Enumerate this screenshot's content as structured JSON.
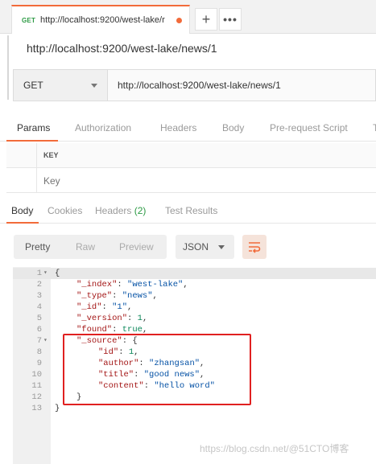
{
  "tab": {
    "method": "GET",
    "title": "http://localhost:9200/west-lake/r"
  },
  "request": {
    "name": "http://localhost:9200/west-lake/news/1",
    "method": "GET",
    "url": "http://localhost:9200/west-lake/news/1"
  },
  "request_tabs": [
    "Params",
    "Authorization",
    "Headers",
    "Body",
    "Pre-request Script",
    "T"
  ],
  "params": {
    "key_header": "KEY",
    "key_placeholder": "Key"
  },
  "response_tabs": {
    "body": "Body",
    "cookies": "Cookies",
    "headers": "Headers",
    "headers_count": "(2)",
    "tests": "Test Results"
  },
  "view_modes": [
    "Pretty",
    "Raw",
    "Preview"
  ],
  "format": "JSON",
  "code_lines": [
    {
      "n": "1",
      "fold": true,
      "indent": 0,
      "parts": [
        [
          "p",
          "{"
        ]
      ]
    },
    {
      "n": "2",
      "indent": 1,
      "parts": [
        [
          "k",
          "\"_index\""
        ],
        [
          "p",
          ": "
        ],
        [
          "s",
          "\"west-lake\""
        ],
        [
          "p",
          ","
        ]
      ]
    },
    {
      "n": "3",
      "indent": 1,
      "parts": [
        [
          "k",
          "\"_type\""
        ],
        [
          "p",
          ": "
        ],
        [
          "s",
          "\"news\""
        ],
        [
          "p",
          ","
        ]
      ]
    },
    {
      "n": "4",
      "indent": 1,
      "parts": [
        [
          "k",
          "\"_id\""
        ],
        [
          "p",
          ": "
        ],
        [
          "s",
          "\"1\""
        ],
        [
          "p",
          ","
        ]
      ]
    },
    {
      "n": "5",
      "indent": 1,
      "parts": [
        [
          "k",
          "\"_version\""
        ],
        [
          "p",
          ": "
        ],
        [
          "n",
          "1"
        ],
        [
          "p",
          ","
        ]
      ]
    },
    {
      "n": "6",
      "indent": 1,
      "parts": [
        [
          "k",
          "\"found\""
        ],
        [
          "p",
          ": "
        ],
        [
          "n",
          "true"
        ],
        [
          "p",
          ","
        ]
      ]
    },
    {
      "n": "7",
      "fold": true,
      "indent": 1,
      "parts": [
        [
          "k",
          "\"_source\""
        ],
        [
          "p",
          ": {"
        ]
      ]
    },
    {
      "n": "8",
      "indent": 2,
      "parts": [
        [
          "k",
          "\"id\""
        ],
        [
          "p",
          ": "
        ],
        [
          "n",
          "1"
        ],
        [
          "p",
          ","
        ]
      ]
    },
    {
      "n": "9",
      "indent": 2,
      "parts": [
        [
          "k",
          "\"author\""
        ],
        [
          "p",
          ": "
        ],
        [
          "s",
          "\"zhangsan\""
        ],
        [
          "p",
          ","
        ]
      ]
    },
    {
      "n": "10",
      "indent": 2,
      "parts": [
        [
          "k",
          "\"title\""
        ],
        [
          "p",
          ": "
        ],
        [
          "s",
          "\"good news\""
        ],
        [
          "p",
          ","
        ]
      ]
    },
    {
      "n": "11",
      "indent": 2,
      "parts": [
        [
          "k",
          "\"content\""
        ],
        [
          "p",
          ": "
        ],
        [
          "s",
          "\"hello word\""
        ]
      ]
    },
    {
      "n": "12",
      "indent": 1,
      "parts": [
        [
          "p",
          "}"
        ]
      ]
    },
    {
      "n": "13",
      "indent": 0,
      "parts": [
        [
          "p",
          "}"
        ]
      ]
    }
  ],
  "watermark": "https://blog.csdn.net/@51CTO博客",
  "colors": {
    "accent": "#f26b3a",
    "get_method": "#2c9a44",
    "highlight_border": "#e02020"
  }
}
